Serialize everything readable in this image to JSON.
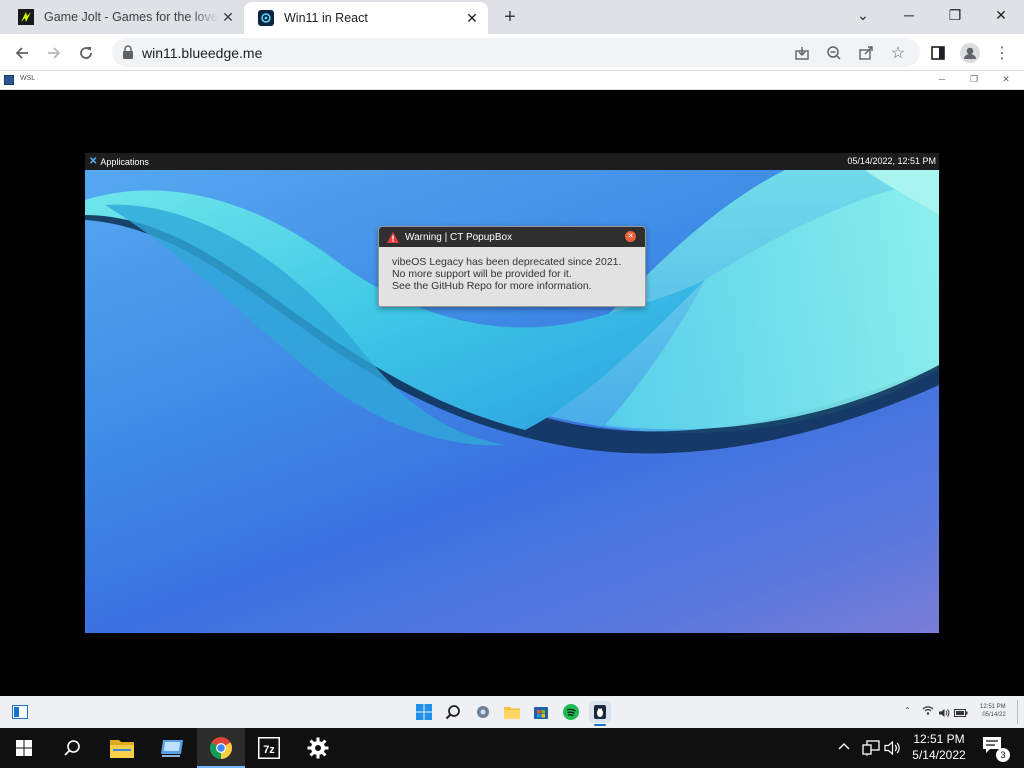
{
  "browser": {
    "tabs": [
      {
        "title": "Game Jolt - Games for the love of",
        "active": false
      },
      {
        "title": "Win11 in React",
        "active": true
      }
    ],
    "url": "win11.blueedge.me"
  },
  "wsl_window": {
    "title": "WSL"
  },
  "vibeos": {
    "menu_label": "Applications",
    "clock": "05/14/2022, 12:51 PM",
    "popup": {
      "title": "Warning | CT PopupBox",
      "lines": [
        "vibeOS Legacy has been deprecated since 2021.",
        "No more support will be provided for it.",
        "See the GitHub Repo for more information."
      ]
    }
  },
  "emulated_taskbar": {
    "time": "12:51 PM",
    "date": "05/14/22"
  },
  "host_taskbar": {
    "apps": [
      "start-icon",
      "search-icon",
      "file-explorer-icon",
      "virtual-machine-icon",
      "chrome-icon",
      "7zip-icon",
      "settings-icon"
    ],
    "time": "12:51 PM",
    "date": "5/14/2022",
    "notifications": "3"
  }
}
